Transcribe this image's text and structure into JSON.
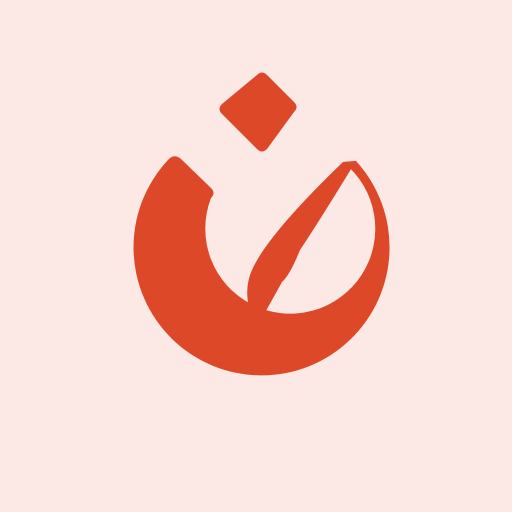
{
  "page": {
    "background_color": "#FCE8E5"
  },
  "logo": {
    "icon": "flame-g-logo-icon",
    "color": "#DC4828",
    "parts": [
      "diamond-dot",
      "ring",
      "inner-leaf"
    ]
  }
}
